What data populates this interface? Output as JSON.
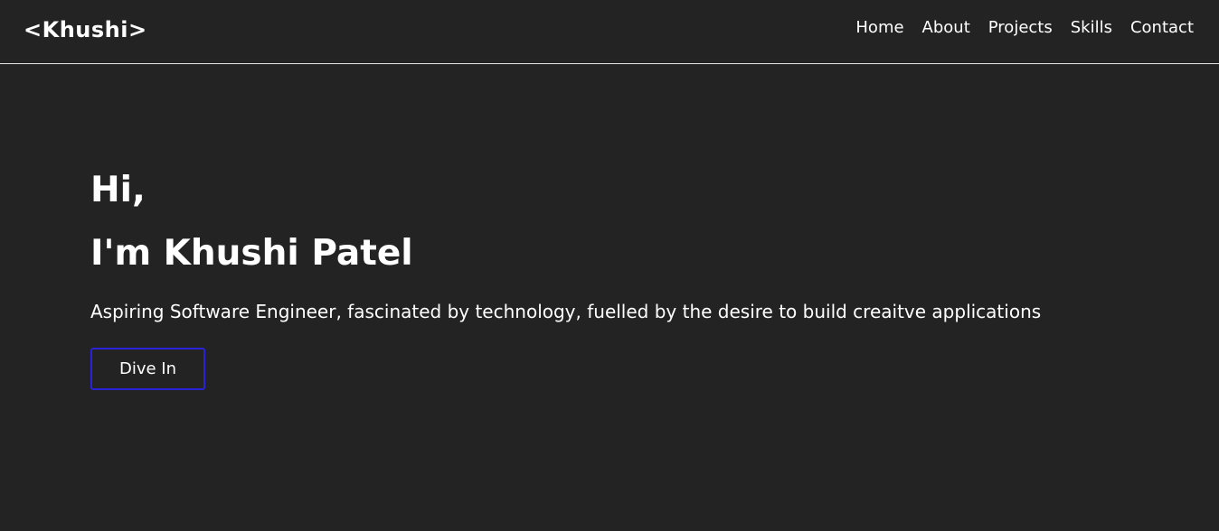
{
  "header": {
    "logo": "<Khushi>",
    "nav": [
      "Home",
      "About",
      "Projects",
      "Skills",
      "Contact"
    ]
  },
  "hero": {
    "greeting": "Hi,",
    "name": "I'm Khushi Patel",
    "tagline": "Aspiring Software Engineer, fascinated by technology, fuelled by the desire to build creaitve applications",
    "cta_label": "Dive In"
  },
  "colors": {
    "background": "#232323",
    "text": "#ffffff",
    "button_border": "#2a22d6",
    "divider": "#e6e6e6"
  }
}
